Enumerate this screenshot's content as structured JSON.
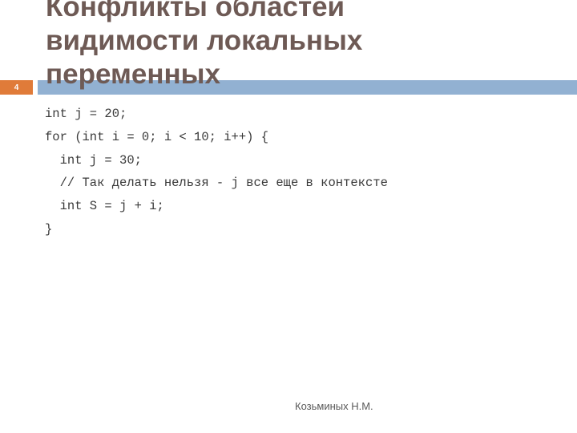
{
  "slide": {
    "number": "4",
    "title_lines": [
      "Конфликты областей",
      "видимости локальных",
      "переменных"
    ],
    "code_lines": [
      "int j = 20;",
      "for (int i = 0; i < 10; i++) {",
      "  int j = 30;",
      "  // Так делать нельзя - j все еще в контексте",
      "  int S = j + i;",
      "}"
    ],
    "footer": "Козьминых Н.М."
  },
  "colors": {
    "accent_orange": "#e07b39",
    "header_bar_blue": "#92b1d2",
    "title_color": "#6e5a55"
  }
}
